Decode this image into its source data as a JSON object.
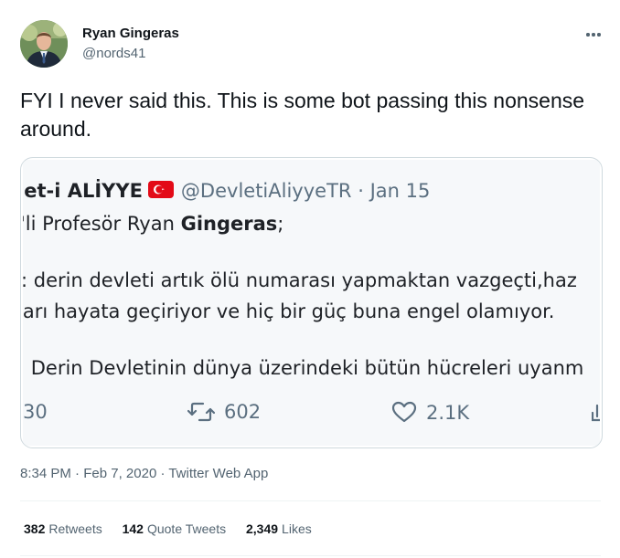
{
  "author": {
    "display_name": "Ryan Gingeras",
    "handle": "@nords41",
    "avatar_icon": "profile-photo"
  },
  "tweet": {
    "text": "FYI I never said this. This is some bot passing this nonsense around."
  },
  "quoted_screenshot": {
    "name": "let-i ALİYYE",
    "flag_icon": "turkey-flag-icon",
    "handle": "@DevletiAliyyeTR",
    "separator": "·",
    "date": "Jan 15",
    "line1_prefix": "'li Profesör Ryan ",
    "line1_bold": "Gingeras",
    "line1_suffix": ";",
    "line2": ": derin devleti artık ölü numarası yapmaktan vazgeçti,haz",
    "line3": "ları hayata geçiriyor ve hiç bir güç buna engel olamıyor.",
    "line4": ": Derin Devletinin dünya üzerindeki bütün hücreleri uyanm",
    "replies": "30",
    "retweets": "602",
    "likes": "2.1K"
  },
  "meta": {
    "time": "8:34 PM",
    "sep1": " · ",
    "date": "Feb 7, 2020",
    "sep2": " · ",
    "source": "Twitter Web App"
  },
  "stats": {
    "retweets_count": "382",
    "retweets_label": "Retweets",
    "quotes_count": "142",
    "quotes_label": "Quote Tweets",
    "likes_count": "2,349",
    "likes_label": "Likes"
  },
  "colors": {
    "text": "#0f1419",
    "secondary": "#536471",
    "border": "#cfd9de",
    "flag_red": "#e30a17"
  }
}
